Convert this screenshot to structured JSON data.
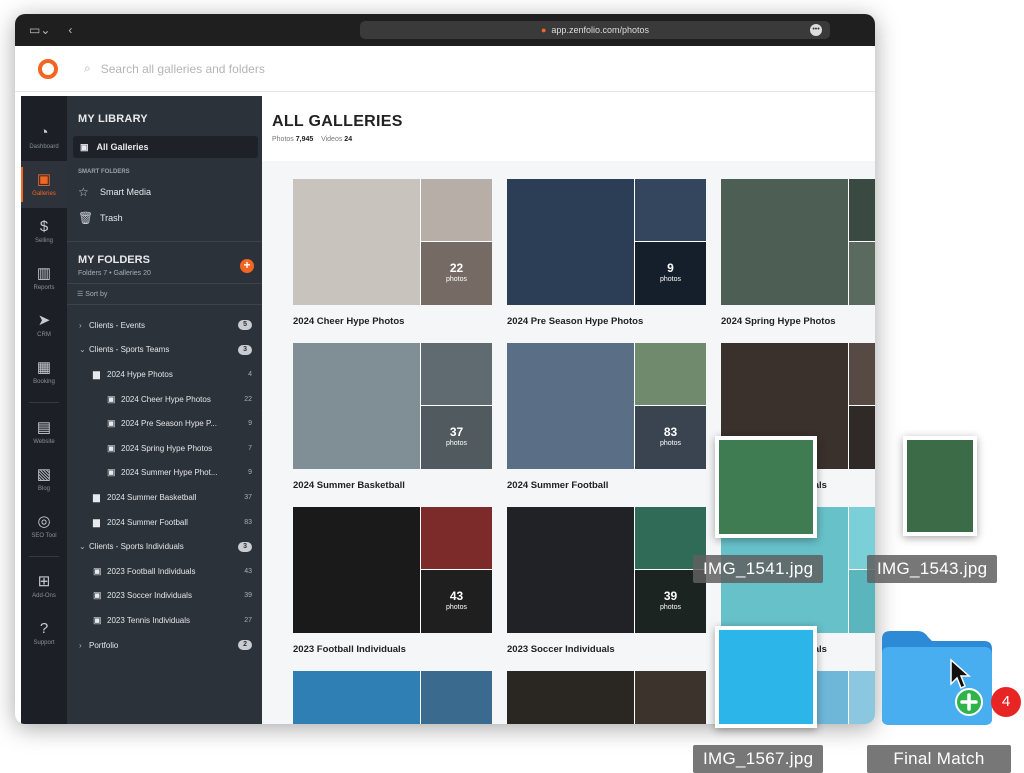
{
  "browser": {
    "url": "app.zenfolio.com/photos"
  },
  "app": {
    "search_placeholder": "Search all galleries and folders"
  },
  "rail": [
    {
      "label": "Dashboard",
      "icon": "dashboard-icon",
      "glyph": "◔"
    },
    {
      "label": "Galleries",
      "icon": "galleries-icon",
      "glyph": "▣",
      "active": true
    },
    {
      "label": "Selling",
      "icon": "dollar-icon",
      "glyph": "$"
    },
    {
      "label": "Reports",
      "icon": "bar-chart-icon",
      "glyph": "▥"
    },
    {
      "label": "CRM",
      "icon": "send-icon",
      "glyph": "➤"
    },
    {
      "label": "Booking",
      "icon": "calendar-icon",
      "glyph": "▦"
    },
    {
      "label": "Website",
      "icon": "website-icon",
      "glyph": "▤"
    },
    {
      "label": "Blog",
      "icon": "blog-icon",
      "glyph": "▧"
    },
    {
      "label": "SEO Tool",
      "icon": "seo-icon",
      "glyph": "◎"
    },
    {
      "label": "Add-Ons",
      "icon": "addons-icon",
      "glyph": "⊞"
    },
    {
      "label": "Support",
      "icon": "help-icon",
      "glyph": "?"
    }
  ],
  "sidebar": {
    "library_title": "MY LIBRARY",
    "all_galleries": "All Galleries",
    "smart_folders_label": "SMART FOLDERS",
    "smart_media": "Smart Media",
    "trash": "Trash",
    "folders_title": "MY FOLDERS",
    "folders_summary": "Folders 7 • Galleries 20",
    "sort_by": "Sort by",
    "tree": [
      {
        "label": "Clients - Events",
        "count": "5",
        "type": "pill",
        "level": 0,
        "chev": "›",
        "icon": ""
      },
      {
        "label": "Clients - Sports Teams",
        "count": "3",
        "type": "pill",
        "level": 0,
        "chev": "⌄",
        "icon": ""
      },
      {
        "label": "2024 Hype Photos",
        "count": "4",
        "type": "num",
        "level": 1,
        "chev": "",
        "icon": "folder"
      },
      {
        "label": "2024 Cheer Hype Photos",
        "count": "22",
        "type": "num",
        "level": 2,
        "chev": "",
        "icon": "gallery"
      },
      {
        "label": "2024 Pre Season Hype P...",
        "count": "9",
        "type": "num",
        "level": 2,
        "chev": "",
        "icon": "gallery"
      },
      {
        "label": "2024 Spring Hype Photos",
        "count": "7",
        "type": "num",
        "level": 2,
        "chev": "",
        "icon": "gallery"
      },
      {
        "label": "2024 Summer Hype Phot...",
        "count": "9",
        "type": "num",
        "level": 2,
        "chev": "",
        "icon": "gallery"
      },
      {
        "label": "2024 Summer Basketball",
        "count": "37",
        "type": "num",
        "level": 1,
        "chev": "",
        "icon": "folder"
      },
      {
        "label": "2024 Summer Football",
        "count": "83",
        "type": "num",
        "level": 1,
        "chev": "",
        "icon": "folder"
      },
      {
        "label": "Clients - Sports Individuals",
        "count": "3",
        "type": "pill",
        "level": 0,
        "chev": "⌄",
        "icon": ""
      },
      {
        "label": "2023 Football Individuals",
        "count": "43",
        "type": "num",
        "level": 1,
        "chev": "",
        "icon": "gallery"
      },
      {
        "label": "2023 Soccer Individuals",
        "count": "39",
        "type": "num",
        "level": 1,
        "chev": "",
        "icon": "gallery"
      },
      {
        "label": "2023 Tennis Individuals",
        "count": "27",
        "type": "num",
        "level": 1,
        "chev": "",
        "icon": "gallery"
      },
      {
        "label": "Portfolio",
        "count": "2",
        "type": "pill",
        "level": 0,
        "chev": "›",
        "icon": ""
      }
    ]
  },
  "main": {
    "title": "ALL GALLERIES",
    "photos_label": "Photos",
    "photos_count": "7,945",
    "videos_label": "Videos",
    "videos_count": "24"
  },
  "galleries": [
    {
      "name": "2024 Cheer Hype Photos",
      "count": "22",
      "count_label": "photos",
      "colors": [
        "#c9c3bd",
        "#b7aea7",
        "#9c8f86"
      ]
    },
    {
      "name": "2024 Pre Season Hype Photos",
      "count": "9",
      "count_label": "photos",
      "colors": [
        "#2b3e55",
        "#34465e",
        "#1d2a3a"
      ]
    },
    {
      "name": "2024 Spring Hype Photos",
      "count": "",
      "count_label": "",
      "colors": [
        "#4d5e54",
        "#3a4a43",
        "#5a6a5f"
      ]
    },
    {
      "name": "2024 Summer Basketball",
      "count": "37",
      "count_label": "photos",
      "colors": [
        "#7f8f95",
        "#5f6b70",
        "#6d7a7f"
      ]
    },
    {
      "name": "2024 Summer Football",
      "count": "83",
      "count_label": "photos",
      "colors": [
        "#5a6e86",
        "#6f8a6d",
        "#4e5b6c"
      ]
    },
    {
      "name": "2024 Tennis Individuals",
      "count": "",
      "count_label": "",
      "colors": [
        "#3a302c",
        "#574a44",
        "#2f2a28"
      ]
    },
    {
      "name": "2023 Football Individuals",
      "count": "43",
      "count_label": "photos",
      "colors": [
        "#1a1a1a",
        "#7d2a2a",
        "#2a2a2a"
      ]
    },
    {
      "name": "2023 Soccer Individuals",
      "count": "39",
      "count_label": "photos",
      "colors": [
        "#202225",
        "#2f6b56",
        "#26302c"
      ]
    },
    {
      "name": "2023 Tennis Individuals",
      "count": "",
      "count_label": "",
      "colors": [
        "#67c1c8",
        "#7ad0d6",
        "#5bb5bd"
      ]
    },
    {
      "name": "",
      "count": "",
      "count_label": "",
      "colors": [
        "#2f7fb5",
        "#3a6b8f",
        "#e2e6ea"
      ]
    },
    {
      "name": "",
      "count": "",
      "count_label": "",
      "colors": [
        "#2a2622",
        "#3b332c",
        "#e8e4e0"
      ]
    },
    {
      "name": "",
      "count": "",
      "count_label": "",
      "colors": [
        "#6fb7d9",
        "#8cc7e0",
        "#bfe1ee"
      ]
    }
  ],
  "drag_items": [
    {
      "filename": "IMG_1541.jpg",
      "color": "#3f7c52"
    },
    {
      "filename": "IMG_1543.jpg",
      "color": "#3c6b48"
    },
    {
      "filename": "IMG_1567.jpg",
      "color": "#2cb5e8"
    }
  ],
  "drop_target": {
    "label": "Final Match",
    "badge": "4"
  },
  "colors": {
    "accent": "#f26522",
    "rail_bg": "#1c2026",
    "sidebar_bg": "#2c323a",
    "folder_blue": "#3fa3e9",
    "badge_red": "#e82525",
    "add_green": "#2fb34a"
  }
}
